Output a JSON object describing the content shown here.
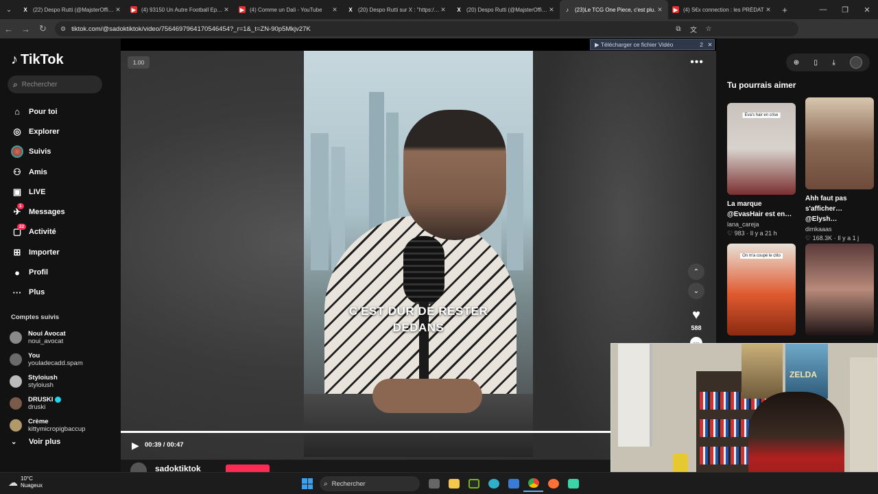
{
  "browser": {
    "tab_menu_icon": "chevron-down-icon",
    "tabs": [
      {
        "title": "(22) Despo Rutti (@MajsterOffi…",
        "icon": "x-logo-icon",
        "active": false
      },
      {
        "title": "(4) 93150 Un Autre Football Ep…",
        "icon": "youtube-icon",
        "active": false
      },
      {
        "title": "(4) Comme un Dali - YouTube",
        "icon": "youtube-icon",
        "active": false
      },
      {
        "title": "(20) Despo Rutti sur X : \"https:/…",
        "icon": "x-logo-icon",
        "active": false
      },
      {
        "title": "(20) Despo Rutti (@MajsterOffi…",
        "icon": "x-logo-icon",
        "active": false
      },
      {
        "title": "(23)Le TCG One Piece, c'est plu…",
        "icon": "tiktok-icon",
        "active": true
      },
      {
        "title": "(4) S€x connection : les PRÉDAT…",
        "icon": "youtube-icon",
        "active": false
      }
    ],
    "url": "tiktok.com/@sadoktiktok/video/7564697964170546454?_r=1&_t=ZN-90p5Mkjv27K"
  },
  "sidebar": {
    "logo": "TikTok",
    "search_placeholder": "Rechercher",
    "nav": [
      {
        "label": "Pour toi",
        "icon": "home-icon",
        "badge": ""
      },
      {
        "label": "Explorer",
        "icon": "compass-icon",
        "badge": ""
      },
      {
        "label": "Suivis",
        "icon": "avatar-icon",
        "badge": ""
      },
      {
        "label": "Amis",
        "icon": "friends-icon",
        "badge": ""
      },
      {
        "label": "LIVE",
        "icon": "live-icon",
        "badge": ""
      },
      {
        "label": "Messages",
        "icon": "messages-icon",
        "badge": "1"
      },
      {
        "label": "Activité",
        "icon": "activity-icon",
        "badge": "22"
      },
      {
        "label": "Importer",
        "icon": "upload-icon",
        "badge": ""
      },
      {
        "label": "Profil",
        "icon": "profile-icon",
        "badge": ""
      },
      {
        "label": "Plus",
        "icon": "more-icon",
        "badge": ""
      }
    ],
    "followed_title": "Comptes suivis",
    "followed": [
      {
        "name": "Noui Avocat",
        "handle": "noui_avocat",
        "verified": false
      },
      {
        "name": "You",
        "handle": "youladecadd.spam",
        "verified": false
      },
      {
        "name": "Styloiush",
        "handle": "styloiush",
        "verified": false
      },
      {
        "name": "DRUSKI",
        "handle": "druski",
        "verified": true
      },
      {
        "name": "Crème",
        "handle": "kittymicropigbaccup",
        "verified": false
      }
    ],
    "see_more": "Voir plus"
  },
  "video": {
    "speed": "1.00",
    "caption_line1": "C'EST DUR DE RESTER",
    "caption_line2": "DEDANS",
    "likes": "588",
    "time": "00:39 / 00:47",
    "progress": 0.83,
    "author": "sadoktiktok"
  },
  "download_banner": {
    "label": "▶ Télécharger ce fichier Vidéo",
    "count": "2"
  },
  "recommendations": {
    "title": "Tu pourrais aimer",
    "items": [
      {
        "title": "La marque @EvasHair est en…",
        "user": "lana_careja",
        "likes": "983",
        "age": "Il y a 21 h",
        "thumb_label": "Eva's hair en crise",
        "colors": [
          "#c9c2bd",
          "#7a2f2f"
        ]
      },
      {
        "title": "Ahh faut pas s'afficher… @Elysh…",
        "user": "dimkaaas",
        "likes": "168.3K",
        "age": "Il y a 1 j",
        "thumb_label": "",
        "colors": [
          "#d9c7b0",
          "#6e4a3a"
        ]
      },
      {
        "title": "",
        "user": "",
        "likes": "",
        "age": "",
        "thumb_label": "On m'a coupé le clito",
        "colors": [
          "#e05a30",
          "#8a2a10"
        ]
      },
      {
        "title": "",
        "user": "",
        "likes": "",
        "age": "",
        "thumb_label": "",
        "colors": [
          "#5a3a3a",
          "#1e1414"
        ]
      }
    ]
  },
  "taskbar": {
    "temperature": "10°C",
    "weather": "Nuageux",
    "search": "Rechercher"
  },
  "webcam": {
    "poster_text": "ZELDA"
  }
}
